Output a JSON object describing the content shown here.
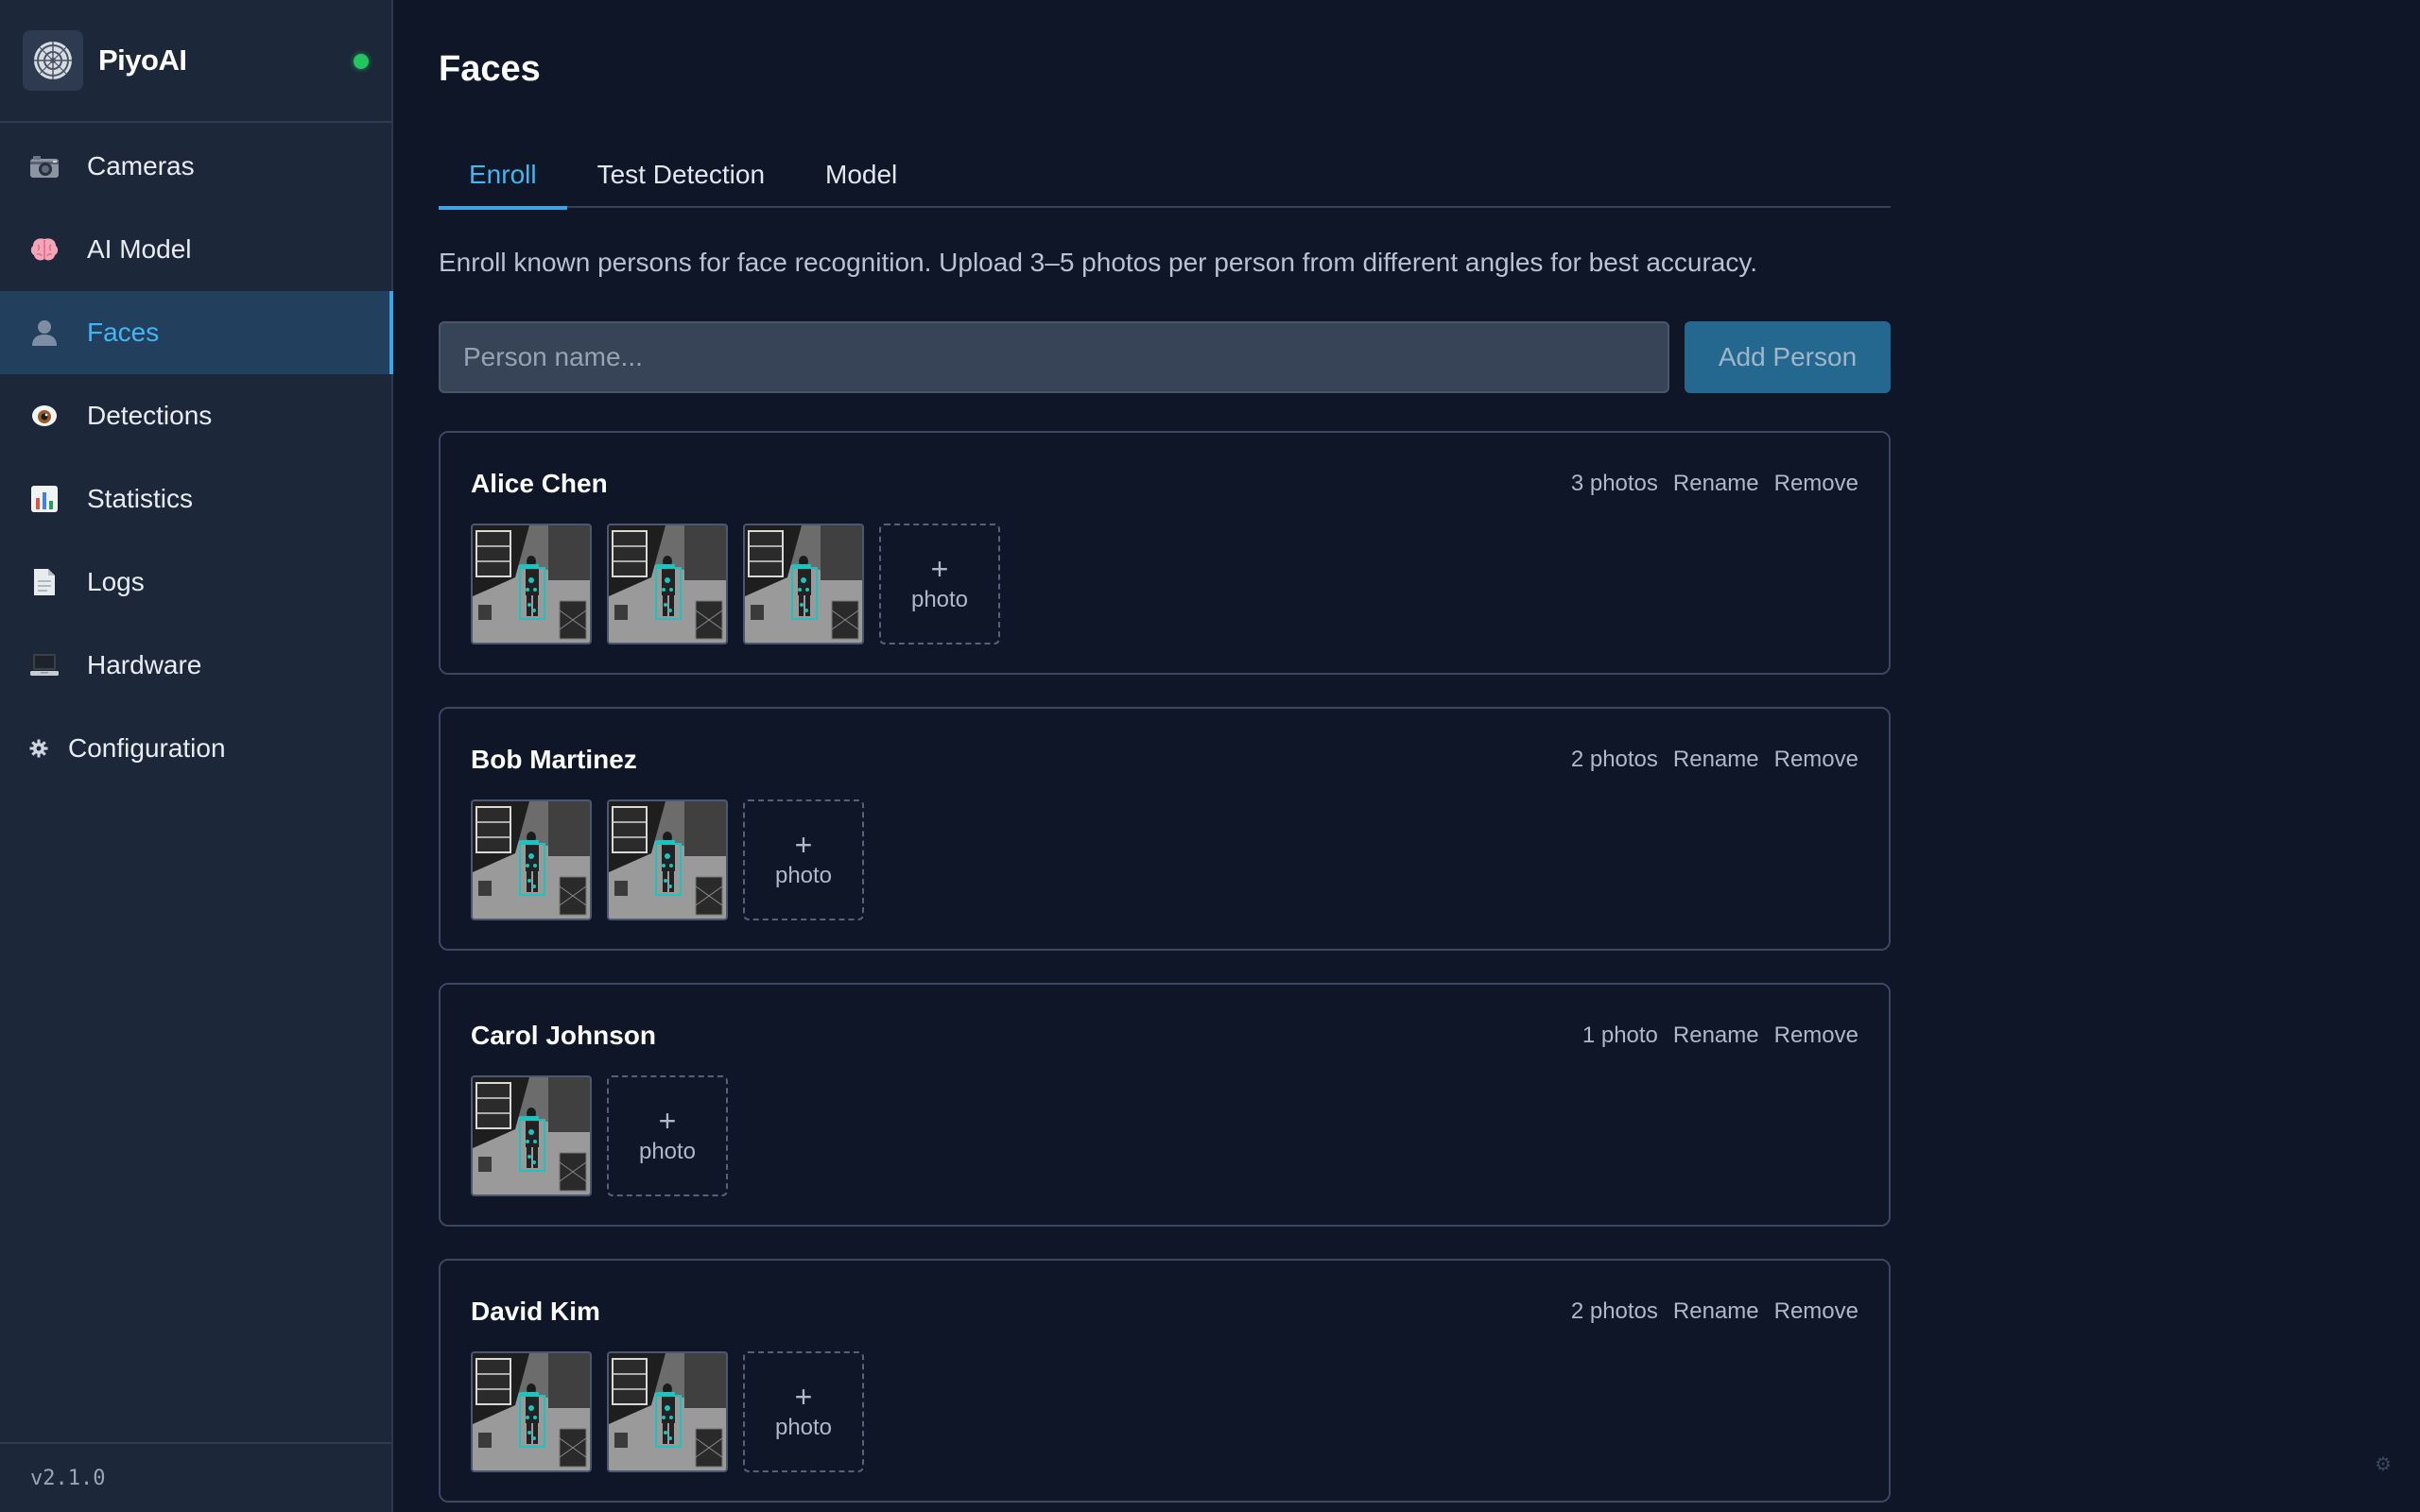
{
  "app": {
    "name": "PiyoAI",
    "version": "v2.1.0",
    "status_color": "#22c55e"
  },
  "sidebar": {
    "items": [
      {
        "label": "Cameras",
        "icon": "camera-icon"
      },
      {
        "label": "AI Model",
        "icon": "brain-icon"
      },
      {
        "label": "Faces",
        "icon": "person-icon",
        "active": true
      },
      {
        "label": "Detections",
        "icon": "eye-icon"
      },
      {
        "label": "Statistics",
        "icon": "bar-chart-icon"
      },
      {
        "label": "Logs",
        "icon": "document-icon"
      },
      {
        "label": "Hardware",
        "icon": "laptop-icon"
      },
      {
        "label": "Configuration",
        "icon": "gear-icon"
      }
    ]
  },
  "page": {
    "title": "Faces",
    "tabs": [
      {
        "label": "Enroll",
        "active": true
      },
      {
        "label": "Test Detection"
      },
      {
        "label": "Model"
      }
    ],
    "description": "Enroll known persons for face recognition. Upload 3–5 photos per person from different angles for best accuracy.",
    "name_placeholder": "Person name...",
    "add_label": "Add Person"
  },
  "persons": [
    {
      "name": "Alice Chen",
      "photo_count": "3 photos",
      "photos": 3
    },
    {
      "name": "Bob Martinez",
      "photo_count": "2 photos",
      "photos": 2
    },
    {
      "name": "Carol Johnson",
      "photo_count": "1 photo",
      "photos": 1
    },
    {
      "name": "David Kim",
      "photo_count": "2 photos",
      "photos": 2
    }
  ],
  "card_actions": {
    "rename": "Rename",
    "remove": "Remove",
    "add_photo_plus": "+",
    "add_photo_label": "photo"
  },
  "colors": {
    "accent": "#42b6f2",
    "background": "#0e1628",
    "sidebar": "#1c2739"
  }
}
